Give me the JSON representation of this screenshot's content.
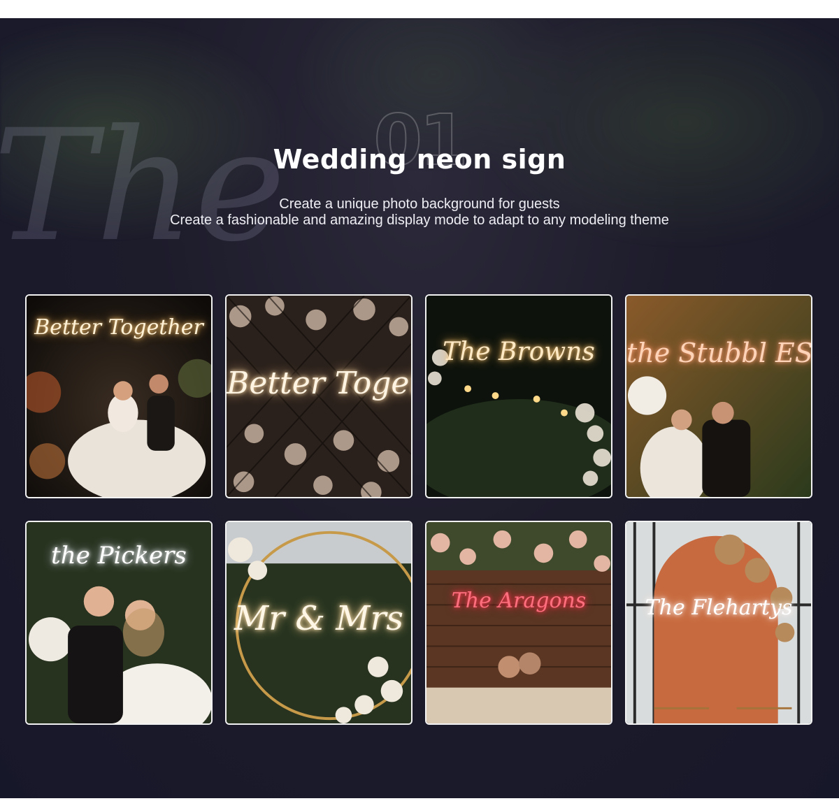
{
  "header": {
    "number": "01",
    "title": "Wedding neon sign",
    "subtitle_line1": "Create a unique photo background for guests",
    "subtitle_line2": "Create a fashionable and amazing display mode to adapt to any modeling theme"
  },
  "background": {
    "script_text": "The"
  },
  "gallery": [
    {
      "sign": "Better Together",
      "neon_color": "#fff1d6",
      "scene": "couple-flower-arch-night"
    },
    {
      "sign": "Better Togethe",
      "neon_color": "#fff4e2",
      "scene": "cherry-blossom-lattice"
    },
    {
      "sign": "The Browns",
      "neon_color": "#ffe9c4",
      "scene": "greenery-arch-string-lights"
    },
    {
      "sign": "the Stubbl EST",
      "neon_color": "#ffd3b8",
      "scene": "couple-kiss-hedge-wall"
    },
    {
      "sign": "the Pickers",
      "neon_color": "#ffffff",
      "scene": "couple-smiling-hedge-wall"
    },
    {
      "sign": "Mr & Mrs",
      "neon_color": "#fff6e6",
      "scene": "gold-hoop-roses-trees"
    },
    {
      "sign": "The Aragons",
      "neon_color": "#ff6f7d",
      "scene": "wood-wall-flower-garland"
    },
    {
      "sign": "The Flehartys",
      "neon_color": "#ffffff",
      "scene": "terracotta-arch-pampas"
    }
  ]
}
